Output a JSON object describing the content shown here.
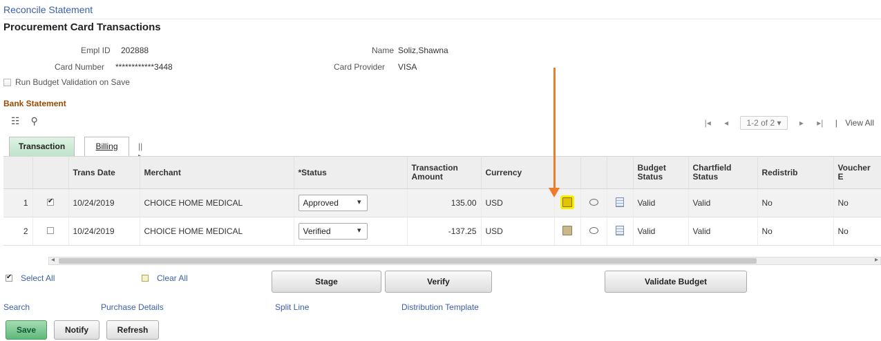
{
  "breadcrumb": "Reconcile Statement",
  "page_title": "Procurement Card Transactions",
  "fields": {
    "empl_id_label": "Empl ID",
    "empl_id": "202888",
    "card_number_label": "Card Number",
    "card_number": "************3448",
    "name_label": "Name",
    "name": "Soliz,Shawna",
    "card_provider_label": "Card Provider",
    "card_provider": "VISA",
    "run_budget_label": "Run Budget Validation on Save"
  },
  "section_title": "Bank Statement",
  "pager": {
    "first": "|◂",
    "prev": "◂",
    "range": "1-2 of 2",
    "next": "▸",
    "last": "▸|",
    "view_all": "View All"
  },
  "tabs": {
    "transaction": "Transaction",
    "billing": "Billing",
    "expand": "||▸"
  },
  "columns": {
    "trans_date": "Trans Date",
    "merchant": "Merchant",
    "status": "*Status",
    "amount": "Transaction Amount",
    "currency": "Currency",
    "budget_status": "Budget Status",
    "chartfield_status": "Chartfield Status",
    "redistrib": "Redistrib",
    "voucher": "Voucher E"
  },
  "rows": [
    {
      "num": "1",
      "checked": true,
      "date": "10/24/2019",
      "merchant": "CHOICE HOME MEDICAL",
      "status": "Approved",
      "amount": "135.00",
      "currency": "USD",
      "budget": "Valid",
      "chartfield": "Valid",
      "redistrib": "No",
      "voucher": "No"
    },
    {
      "num": "2",
      "checked": false,
      "date": "10/24/2019",
      "merchant": "CHOICE HOME MEDICAL",
      "status": "Verified",
      "amount": "-137.25",
      "currency": "USD",
      "budget": "Valid",
      "chartfield": "Valid",
      "redistrib": "No",
      "voucher": "No"
    }
  ],
  "actions": {
    "select_all": "Select All",
    "clear_all": "Clear All",
    "stage": "Stage",
    "verify": "Verify",
    "validate_budget": "Validate Budget"
  },
  "links": {
    "search": "Search",
    "purchase_details": "Purchase Details",
    "split_line": "Split Line",
    "distribution_template": "Distribution Template"
  },
  "bottom_buttons": {
    "save": "Save",
    "notify": "Notify",
    "refresh": "Refresh"
  },
  "colors": {
    "annotation_arrow": "#ef7b2a",
    "highlight": "#f4f000",
    "section_title": "#9a4a00",
    "link": "#3a5fa8",
    "save_button": "#5fb879"
  }
}
